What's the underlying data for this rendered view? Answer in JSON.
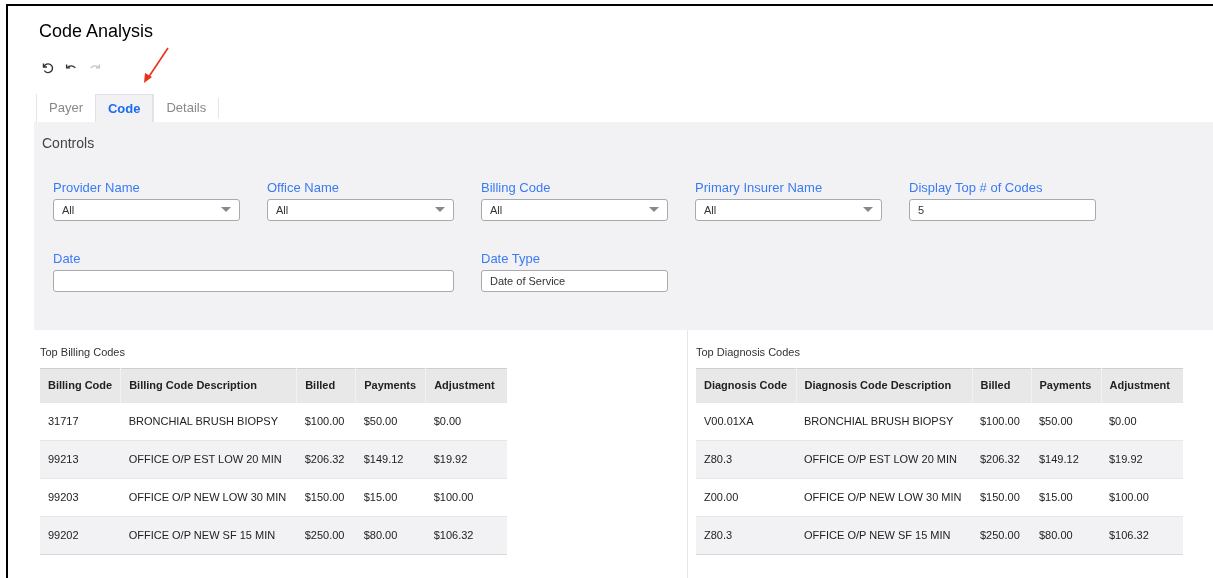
{
  "page": {
    "title": "Code Analysis"
  },
  "toolbar": [
    {
      "kind": "refresh",
      "disabled": false
    },
    {
      "kind": "undo",
      "disabled": false
    },
    {
      "kind": "redo",
      "disabled": true
    }
  ],
  "tabs": [
    {
      "label": "Payer",
      "selected": false
    },
    {
      "label": "Code",
      "selected": true
    },
    {
      "label": "Details",
      "selected": false
    }
  ],
  "controls": {
    "title": "Controls",
    "fields": [
      {
        "label": "Provider Name",
        "kind": "select",
        "value": "All"
      },
      {
        "label": "Office Name",
        "kind": "select",
        "value": "All"
      },
      {
        "label": "Billing Code",
        "kind": "select",
        "value": "All"
      },
      {
        "label": "Primary Insurer Name",
        "kind": "select",
        "value": "All"
      },
      {
        "label": "Display Top # of Codes",
        "kind": "text",
        "value": "5"
      },
      {
        "label": "Date",
        "kind": "wide"
      },
      {
        "label": "Date Type",
        "kind": "text",
        "value": "Date of Service"
      }
    ]
  },
  "tables": [
    {
      "title": "Top Billing Codes",
      "columns": [
        "Billing Code",
        "Billing Code Description",
        "Billed",
        "Payments",
        "Adjustment"
      ],
      "rows": [
        [
          "31717",
          "BRONCHIAL BRUSH BIOPSY",
          "$100.00",
          "$50.00",
          "$0.00"
        ],
        [
          "99213",
          "OFFICE O/P EST LOW 20 MIN",
          "$206.32",
          "$149.12",
          "$19.92"
        ],
        [
          "99203",
          "OFFICE O/P NEW LOW 30 MIN",
          "$150.00",
          "$15.00",
          "$100.00"
        ],
        [
          "99202",
          "OFFICE O/P NEW SF 15 MIN",
          "$250.00",
          "$80.00",
          "$106.32"
        ]
      ]
    },
    {
      "title": "Top Diagnosis Codes",
      "columns": [
        "Diagnosis Code",
        "Diagnosis Code Description",
        "Billed",
        "Payments",
        "Adjustment"
      ],
      "rows": [
        [
          "V00.01XA",
          "BRONCHIAL BRUSH BIOPSY",
          "$100.00",
          "$50.00",
          "$0.00"
        ],
        [
          "Z80.3",
          "OFFICE O/P EST LOW 20 MIN",
          "$206.32",
          "$149.12",
          "$19.92"
        ],
        [
          "Z00.00",
          "OFFICE O/P NEW LOW 30 MIN",
          "$150.00",
          "$15.00",
          "$100.00"
        ],
        [
          "Z80.3",
          "OFFICE O/P NEW SF 15 MIN",
          "$250.00",
          "$80.00",
          "$106.32"
        ]
      ]
    }
  ]
}
